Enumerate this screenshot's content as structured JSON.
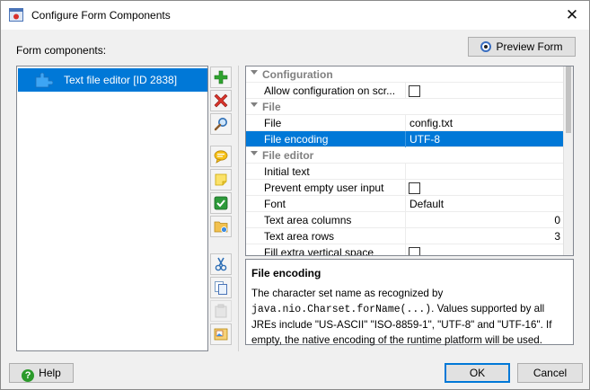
{
  "window": {
    "title": "Configure Form Components",
    "close_glyph": "✕"
  },
  "left": {
    "label": "Form components:",
    "items": [
      {
        "label": "Text file editor [ID 2838]",
        "icon": "puzzle-icon",
        "selected": true
      }
    ]
  },
  "toolbar": [
    {
      "name": "add-component-button",
      "icon": "plus-icon"
    },
    {
      "name": "remove-component-button",
      "icon": "x-icon"
    },
    {
      "name": "search-component-button",
      "icon": "magnifier-icon"
    },
    {
      "name": "comment-button",
      "icon": "speech-bubble-icon"
    },
    {
      "name": "note-button",
      "icon": "note-icon"
    },
    {
      "name": "validate-button",
      "icon": "checkmark-icon"
    },
    {
      "name": "folder-button",
      "icon": "folder-icon"
    },
    {
      "name": "cut-button",
      "icon": "scissors-icon"
    },
    {
      "name": "copy-button",
      "icon": "copy-icon"
    },
    {
      "name": "paste-button",
      "icon": "paste-icon"
    },
    {
      "name": "image-button",
      "icon": "picture-icon"
    }
  ],
  "preview_button": {
    "label": "Preview Form"
  },
  "properties": {
    "categories": {
      "configuration": "Configuration",
      "file": "File",
      "file_editor": "File editor"
    },
    "rows": {
      "allow_config": {
        "name": "Allow configuration on scr...",
        "checked": false
      },
      "file": {
        "name": "File",
        "value": "config.txt"
      },
      "file_encoding": {
        "name": "File encoding",
        "value": "UTF-8"
      },
      "initial_text": {
        "name": "Initial text",
        "value": ""
      },
      "prevent_empty": {
        "name": "Prevent empty user input",
        "checked": false
      },
      "font": {
        "name": "Font",
        "value": "Default"
      },
      "columns": {
        "name": "Text area columns",
        "value": "0"
      },
      "rows": {
        "name": "Text area rows",
        "value": "3"
      },
      "fill_space": {
        "name": "Fill extra vertical space",
        "checked": false
      }
    }
  },
  "description": {
    "title": "File encoding",
    "text_before": "The character set name as recognized by ",
    "code": "java.nio.Charset.forName(...)",
    "text_after": ". Values supported by all JREs include \"US-ASCII\" \"ISO-8859-1\", \"UTF-8\" and \"UTF-16\". If empty, the native encoding of the runtime platform will be used."
  },
  "buttons": {
    "help": "Help",
    "ok": "OK",
    "cancel": "Cancel"
  },
  "colors": {
    "selection": "#0078d7",
    "background": "#f0f0f0"
  }
}
